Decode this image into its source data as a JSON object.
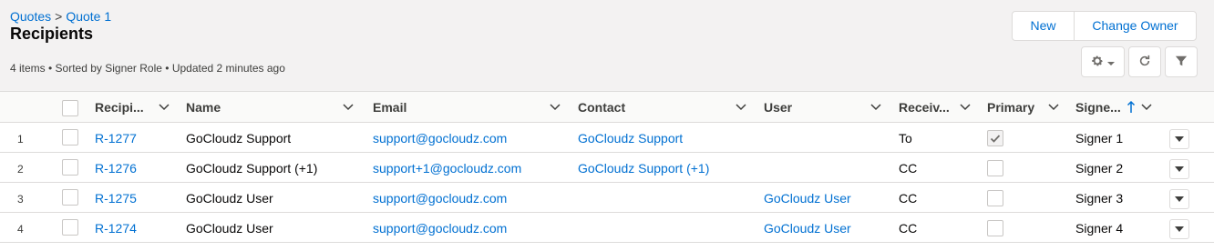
{
  "breadcrumb": {
    "parent": "Quotes",
    "separator": ">",
    "current": "Quote 1"
  },
  "page": {
    "title": "Recipients",
    "meta": "4 items • Sorted by Signer Role • Updated 2 minutes ago"
  },
  "actions": {
    "new": "New",
    "change_owner": "Change Owner"
  },
  "colors": {
    "link": "#0070d2",
    "header_bg": "#f3f2f2",
    "border": "#dddbda"
  },
  "table": {
    "columns": {
      "recipient": "Recipi...",
      "name": "Name",
      "email": "Email",
      "contact": "Contact",
      "user": "User",
      "receive": "Receiv...",
      "primary": "Primary",
      "signer": "Signe..."
    },
    "rows": [
      {
        "num": "1",
        "id": "R-1277",
        "name": "GoCloudz Support",
        "email": "support@gocloudz.com",
        "contact": "GoCloudz Support",
        "user": "",
        "receive": "To",
        "primary": true,
        "signer": "Signer 1"
      },
      {
        "num": "2",
        "id": "R-1276",
        "name": "GoCloudz Support (+1)",
        "email": "support+1@gocloudz.com",
        "contact": "GoCloudz Support (+1)",
        "user": "",
        "receive": "CC",
        "primary": false,
        "signer": "Signer 2"
      },
      {
        "num": "3",
        "id": "R-1275",
        "name": "GoCloudz User",
        "email": "support@gocloudz.com",
        "contact": "",
        "user": "GoCloudz User",
        "receive": "CC",
        "primary": false,
        "signer": "Signer 3"
      },
      {
        "num": "4",
        "id": "R-1274",
        "name": "GoCloudz User",
        "email": "support@gocloudz.com",
        "contact": "",
        "user": "GoCloudz User",
        "receive": "CC",
        "primary": false,
        "signer": "Signer 4"
      }
    ]
  }
}
